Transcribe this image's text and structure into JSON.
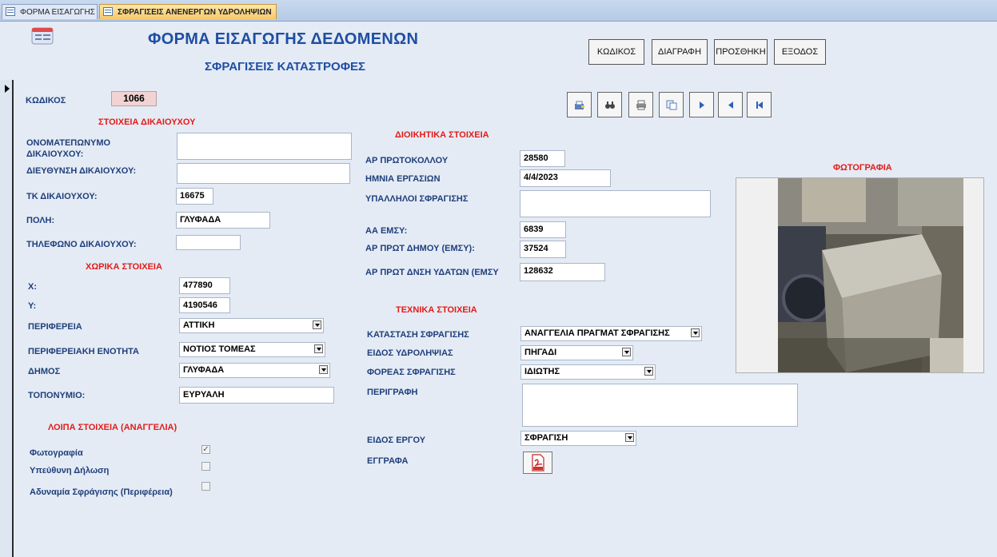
{
  "tabs": [
    {
      "label": "ΦΟΡΜΑ ΕΙΣΑΓΩΓΗΣ"
    },
    {
      "label": "ΣΦΡΑΓΙΣΕΙΣ ΑΝΕΝΕΡΓΩΝ ΥΔΡΟΛΗΨΙΩΝ"
    }
  ],
  "header": {
    "title": "ΦΟΡΜΑ ΕΙΣΑΓΩΓΗΣ ΔΕΔΟΜΕΝΩΝ",
    "subtitle": "ΣΦΡΑΓΙΣΕΙΣ ΚΑΤΑΣΤΡΟΦΕΣ",
    "buttons": [
      "ΚΩΔΙΚΟΣ",
      "ΔΙΑΓΡΑΦΗ",
      "ΠΡΟΣΘΗΚΗ",
      "ΕΞΟΔΟΣ"
    ]
  },
  "record": {
    "code_label": "ΚΩΔΙΚΟΣ",
    "code_value": "1066"
  },
  "navigation": [
    "save-record-icon",
    "find-icon",
    "print-icon",
    "copy-icon",
    "next-record-icon",
    "previous-record-icon",
    "first-record-icon"
  ],
  "beneficiary": {
    "section": "ΣΤΟΙΧΕΙΑ ΔΙΚΑΙΟΥΧΟΥ",
    "name_label": "ΟΝΟΜΑΤΕΠΩΝΥΜΟ ΔΙΚΑΙΟΥΧΟΥ:",
    "name_value": "",
    "address_label": "ΔΙΕΥΘΥΝΣΗ ΔΙΚΑΙΟΥΧΟΥ:",
    "address_value": "",
    "postcode_label": "ΤΚ ΔΙΚΑΙΟΥΧΟΥ:",
    "postcode_value": "16675",
    "city_label": "ΠΟΛΗ:",
    "city_value": "ΓΛΥΦΑΔΑ",
    "phone_label": "ΤΗΛΕΦΩΝΟ ΔΙΚΑΙΟΥΧΟΥ:",
    "phone_value": ""
  },
  "spatial": {
    "section": "ΧΩΡΙΚΑ ΣΤΟΙΧΕΙΑ",
    "x_label": "X:",
    "x_value": "477890",
    "y_label": "Y:",
    "y_value": "4190546",
    "region_label": "ΠΕΡΙΦΕΡΕΙΑ",
    "region_value": "ΑΤΤΙΚΗ",
    "unit_label": "ΠΕΡΙΦΕΡΕΙΑΚΗ ΕΝΟΤΗΤΑ",
    "unit_value": "ΝΟΤΙΟΣ ΤΟΜΕΑΣ",
    "municipality_label": "ΔΗΜΟΣ",
    "municipality_value": "ΓΛΥΦΑΔΑ",
    "place_label": "ΤΟΠΟΝΥΜΙΟ:",
    "place_value": "ΕΥΡΥΑΛΗ"
  },
  "other": {
    "section": "ΛΟΙΠΑ ΣΤΟΙΧΕΙΑ (ΑΝΑΓΓΕΛΙΑ)",
    "photo_label": "Φωτογραφία",
    "photo_checked": true,
    "declaration_label": "Υπεύθυνη Δήλωση",
    "declaration_checked": false,
    "inability_label": "Αδυναμία Σφράγισης (Περιφέρεια)",
    "inability_checked": false
  },
  "admin": {
    "section": "ΔΙΟΙΚΗΤΙΚΑ ΣΤΟΙΧΕΙΑ",
    "protocol_label": "ΑΡ ΠΡΩΤΟΚΟΛΛΟΥ",
    "protocol_value": "28580",
    "date_label": "ΗΜΝΙΑ ΕΡΓΑΣΙΩΝ",
    "date_value": "4/4/2023",
    "staff_label": "ΥΠΑΛΛΗΛΟΙ ΣΦΡΑΓΙΣΗΣ",
    "staff_value": "",
    "aa_label": "ΑΑ ΕΜΣΥ:",
    "aa_value": "6839",
    "municipal_protocol_label": "ΑΡ ΠΡΩΤ ΔΗΜΟΥ (ΕΜΣΥ):",
    "municipal_protocol_value": "37524",
    "water_protocol_label": "ΑΡ ΠΡΩΤ ΔΝΣΗ ΥΔΑΤΩΝ (ΕΜΣΥ",
    "water_protocol_value": "128632"
  },
  "technical": {
    "section": "ΤΕΧΝΙΚΑ ΣΤΟΙΧΕΙΑ",
    "status_label": "ΚΑΤΑΣΤΑΣΗ ΣΦΡΑΓΙΣΗΣ",
    "status_value": "ΑΝΑΓΓΕΛΙΑ ΠΡΑΓΜΑΤ ΣΦΡΑΓΙΣΗΣ",
    "type_label": "ΕΙΔΟΣ ΥΔΡΟΛΗΨΙΑΣ",
    "type_value": "ΠΗΓΑΔΙ",
    "agency_label": "ΦΟΡΕΑΣ ΣΦΡΑΓΙΣΗΣ",
    "agency_value": "ΙΔΙΩΤΗΣ",
    "description_label": "ΠΕΡΙΓΡΑΦΗ",
    "description_value": "",
    "work_label": "ΕΙΔΟΣ ΕΡΓΟΥ",
    "work_value": "ΣΦΡΑΓΙΣΗ",
    "docs_label": "ΕΓΓΡΑΦΑ"
  },
  "photo_section": {
    "title": "ΦΩΤΟΓΡΑΦΙΑ"
  },
  "colors": {
    "label": "#1f3f7a",
    "section": "#e41b17",
    "title": "#1f4ea3",
    "background": "#e4ebf5"
  }
}
